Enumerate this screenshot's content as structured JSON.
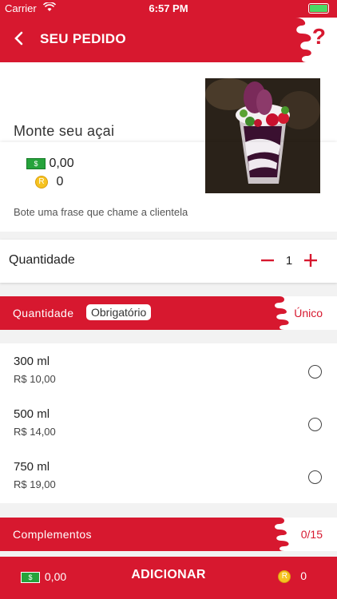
{
  "status_bar": {
    "carrier": "Carrier",
    "time": "6:57 PM"
  },
  "nav": {
    "title": "SEU PEDIDO",
    "help": "?"
  },
  "product": {
    "name": "Monte seu açai",
    "price": "0,00",
    "points": "0",
    "tagline": "Bote uma frase que chame a clientela"
  },
  "quantity": {
    "label": "Quantidade",
    "value": "1"
  },
  "size_section": {
    "title": "Quantidade",
    "badge": "Obrigatório",
    "rule": "Único"
  },
  "options": [
    {
      "name": "300 ml",
      "price": "R$ 10,00"
    },
    {
      "name": "500 ml",
      "price": "R$ 14,00"
    },
    {
      "name": "750 ml",
      "price": "R$ 19,00"
    }
  ],
  "complements_section": {
    "title": "Complementos",
    "count": "0/15"
  },
  "bottom": {
    "total": "0,00",
    "action": "ADICIONAR",
    "points": "0"
  },
  "icons": {
    "money": "money-bill-icon",
    "coin": "coin-icon",
    "money_glyph": "$",
    "coin_glyph": "R"
  },
  "colors": {
    "brand": "#d7182f",
    "money": "#25a33b",
    "coin": "#f6c320"
  }
}
